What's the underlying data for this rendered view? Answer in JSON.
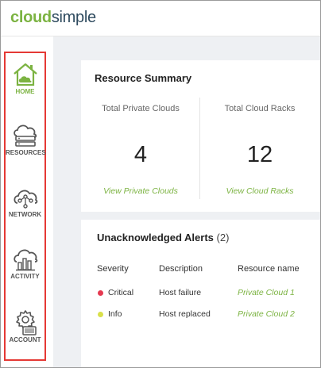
{
  "brand": {
    "part1": "cloud",
    "part2": "simple"
  },
  "nav": [
    {
      "label": "HOME",
      "icon": "home-icon",
      "active": true
    },
    {
      "label": "RESOURCES",
      "icon": "resources-icon",
      "active": false
    },
    {
      "label": "NETWORK",
      "icon": "network-icon",
      "active": false
    },
    {
      "label": "ACTIVITY",
      "icon": "activity-icon",
      "active": false
    },
    {
      "label": "ACCOUNT",
      "icon": "account-icon",
      "active": false
    }
  ],
  "summary": {
    "title": "Resource Summary",
    "private_clouds": {
      "label": "Total Private Clouds",
      "value": "4",
      "link": "View Private Clouds"
    },
    "cloud_racks": {
      "label": "Total Cloud Racks",
      "value": "12",
      "link": "View Cloud Racks"
    }
  },
  "alerts": {
    "title": "Unacknowledged Alerts",
    "count": "(2)",
    "headers": [
      "Severity",
      "Description",
      "Resource name"
    ],
    "rows": [
      {
        "severity": "Critical",
        "severity_color": "#e53950",
        "description": "Host failure",
        "resource": "Private Cloud 1"
      },
      {
        "severity": "Info",
        "severity_color": "#d9e04a",
        "description": "Host replaced",
        "resource": "Private Cloud 2"
      }
    ]
  },
  "colors": {
    "accent": "#7cb342",
    "highlight_border": "#e53935"
  }
}
